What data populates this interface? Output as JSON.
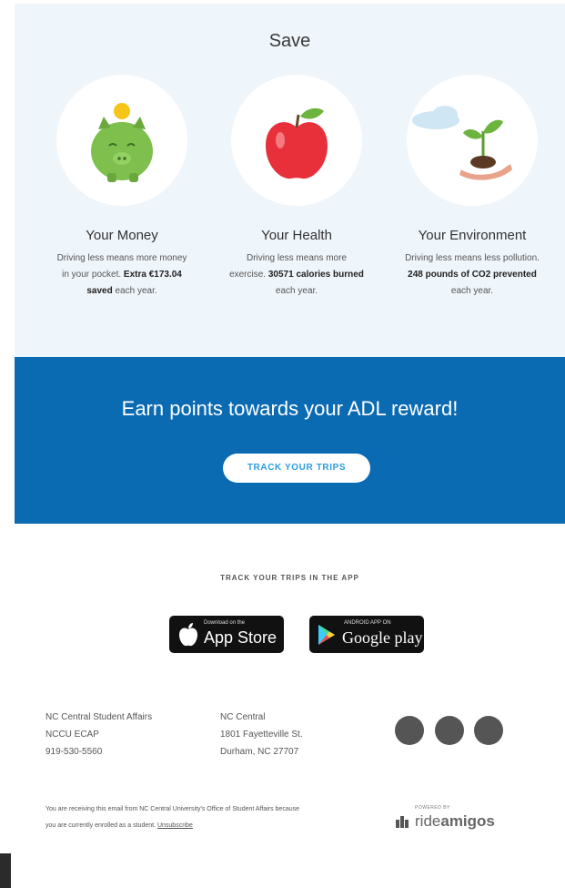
{
  "save": {
    "title": "Save",
    "items": [
      {
        "heading": "Your Money",
        "text_pre": "Driving less means more money in your pocket. ",
        "text_bold": "Extra €173.04 saved",
        "text_post": " each year."
      },
      {
        "heading": "Your Health",
        "text_pre": "Driving less means more exercise. ",
        "text_bold": "30571 calories burned",
        "text_post": " each year."
      },
      {
        "heading": "Your Environment",
        "text_pre": "Driving less means less pollution. ",
        "text_bold": "248 pounds of CO2 prevented",
        "text_post": " each year."
      }
    ]
  },
  "cta": {
    "title": "Earn points towards your ADL reward!",
    "button": "TRACK YOUR TRIPS"
  },
  "apps": {
    "label": "TRACK YOUR TRIPS IN THE APP",
    "app_store_small": "Download on the",
    "app_store_big": "App Store",
    "google_small": "ANDROID APP ON",
    "google_big": "Google play"
  },
  "footer": {
    "addr1": [
      "NC Central Student Affairs",
      "NCCU ECAP",
      "919-530-5560"
    ],
    "addr2": [
      "NC Central",
      "1801 Fayetteville St.",
      "Durham, NC 27707"
    ],
    "note": "You are receiving this email from NC Central University's Office of Student Affairs because you are currently enrolled as a student.",
    "unsubscribe": "Unsubscribe",
    "powered_by": "POWERED BY",
    "brand_ride": "ride",
    "brand_amigos": "amigos"
  },
  "colors": {
    "save_bg": "#eef5fb",
    "cta_bg": "#0a6bb3",
    "button_text": "#2d9de0"
  }
}
